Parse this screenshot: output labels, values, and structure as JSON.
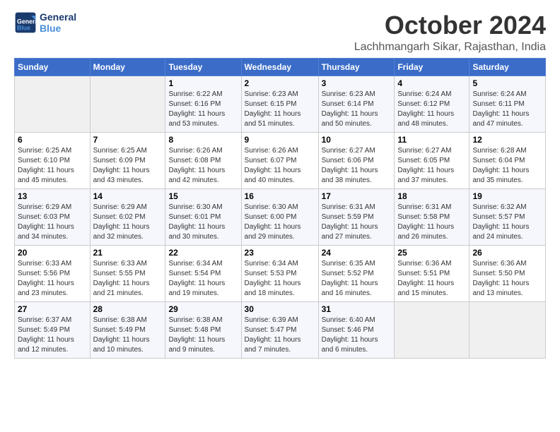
{
  "logo": {
    "line1": "General",
    "line2": "Blue"
  },
  "title": "October 2024",
  "location": "Lachhmangarh Sikar, Rajasthan, India",
  "days_of_week": [
    "Sunday",
    "Monday",
    "Tuesday",
    "Wednesday",
    "Thursday",
    "Friday",
    "Saturday"
  ],
  "weeks": [
    [
      {
        "day": "",
        "info": ""
      },
      {
        "day": "",
        "info": ""
      },
      {
        "day": "1",
        "info": "Sunrise: 6:22 AM\nSunset: 6:16 PM\nDaylight: 11 hours\nand 53 minutes."
      },
      {
        "day": "2",
        "info": "Sunrise: 6:23 AM\nSunset: 6:15 PM\nDaylight: 11 hours\nand 51 minutes."
      },
      {
        "day": "3",
        "info": "Sunrise: 6:23 AM\nSunset: 6:14 PM\nDaylight: 11 hours\nand 50 minutes."
      },
      {
        "day": "4",
        "info": "Sunrise: 6:24 AM\nSunset: 6:12 PM\nDaylight: 11 hours\nand 48 minutes."
      },
      {
        "day": "5",
        "info": "Sunrise: 6:24 AM\nSunset: 6:11 PM\nDaylight: 11 hours\nand 47 minutes."
      }
    ],
    [
      {
        "day": "6",
        "info": "Sunrise: 6:25 AM\nSunset: 6:10 PM\nDaylight: 11 hours\nand 45 minutes."
      },
      {
        "day": "7",
        "info": "Sunrise: 6:25 AM\nSunset: 6:09 PM\nDaylight: 11 hours\nand 43 minutes."
      },
      {
        "day": "8",
        "info": "Sunrise: 6:26 AM\nSunset: 6:08 PM\nDaylight: 11 hours\nand 42 minutes."
      },
      {
        "day": "9",
        "info": "Sunrise: 6:26 AM\nSunset: 6:07 PM\nDaylight: 11 hours\nand 40 minutes."
      },
      {
        "day": "10",
        "info": "Sunrise: 6:27 AM\nSunset: 6:06 PM\nDaylight: 11 hours\nand 38 minutes."
      },
      {
        "day": "11",
        "info": "Sunrise: 6:27 AM\nSunset: 6:05 PM\nDaylight: 11 hours\nand 37 minutes."
      },
      {
        "day": "12",
        "info": "Sunrise: 6:28 AM\nSunset: 6:04 PM\nDaylight: 11 hours\nand 35 minutes."
      }
    ],
    [
      {
        "day": "13",
        "info": "Sunrise: 6:29 AM\nSunset: 6:03 PM\nDaylight: 11 hours\nand 34 minutes."
      },
      {
        "day": "14",
        "info": "Sunrise: 6:29 AM\nSunset: 6:02 PM\nDaylight: 11 hours\nand 32 minutes."
      },
      {
        "day": "15",
        "info": "Sunrise: 6:30 AM\nSunset: 6:01 PM\nDaylight: 11 hours\nand 30 minutes."
      },
      {
        "day": "16",
        "info": "Sunrise: 6:30 AM\nSunset: 6:00 PM\nDaylight: 11 hours\nand 29 minutes."
      },
      {
        "day": "17",
        "info": "Sunrise: 6:31 AM\nSunset: 5:59 PM\nDaylight: 11 hours\nand 27 minutes."
      },
      {
        "day": "18",
        "info": "Sunrise: 6:31 AM\nSunset: 5:58 PM\nDaylight: 11 hours\nand 26 minutes."
      },
      {
        "day": "19",
        "info": "Sunrise: 6:32 AM\nSunset: 5:57 PM\nDaylight: 11 hours\nand 24 minutes."
      }
    ],
    [
      {
        "day": "20",
        "info": "Sunrise: 6:33 AM\nSunset: 5:56 PM\nDaylight: 11 hours\nand 23 minutes."
      },
      {
        "day": "21",
        "info": "Sunrise: 6:33 AM\nSunset: 5:55 PM\nDaylight: 11 hours\nand 21 minutes."
      },
      {
        "day": "22",
        "info": "Sunrise: 6:34 AM\nSunset: 5:54 PM\nDaylight: 11 hours\nand 19 minutes."
      },
      {
        "day": "23",
        "info": "Sunrise: 6:34 AM\nSunset: 5:53 PM\nDaylight: 11 hours\nand 18 minutes."
      },
      {
        "day": "24",
        "info": "Sunrise: 6:35 AM\nSunset: 5:52 PM\nDaylight: 11 hours\nand 16 minutes."
      },
      {
        "day": "25",
        "info": "Sunrise: 6:36 AM\nSunset: 5:51 PM\nDaylight: 11 hours\nand 15 minutes."
      },
      {
        "day": "26",
        "info": "Sunrise: 6:36 AM\nSunset: 5:50 PM\nDaylight: 11 hours\nand 13 minutes."
      }
    ],
    [
      {
        "day": "27",
        "info": "Sunrise: 6:37 AM\nSunset: 5:49 PM\nDaylight: 11 hours\nand 12 minutes."
      },
      {
        "day": "28",
        "info": "Sunrise: 6:38 AM\nSunset: 5:49 PM\nDaylight: 11 hours\nand 10 minutes."
      },
      {
        "day": "29",
        "info": "Sunrise: 6:38 AM\nSunset: 5:48 PM\nDaylight: 11 hours\nand 9 minutes."
      },
      {
        "day": "30",
        "info": "Sunrise: 6:39 AM\nSunset: 5:47 PM\nDaylight: 11 hours\nand 7 minutes."
      },
      {
        "day": "31",
        "info": "Sunrise: 6:40 AM\nSunset: 5:46 PM\nDaylight: 11 hours\nand 6 minutes."
      },
      {
        "day": "",
        "info": ""
      },
      {
        "day": "",
        "info": ""
      }
    ]
  ]
}
